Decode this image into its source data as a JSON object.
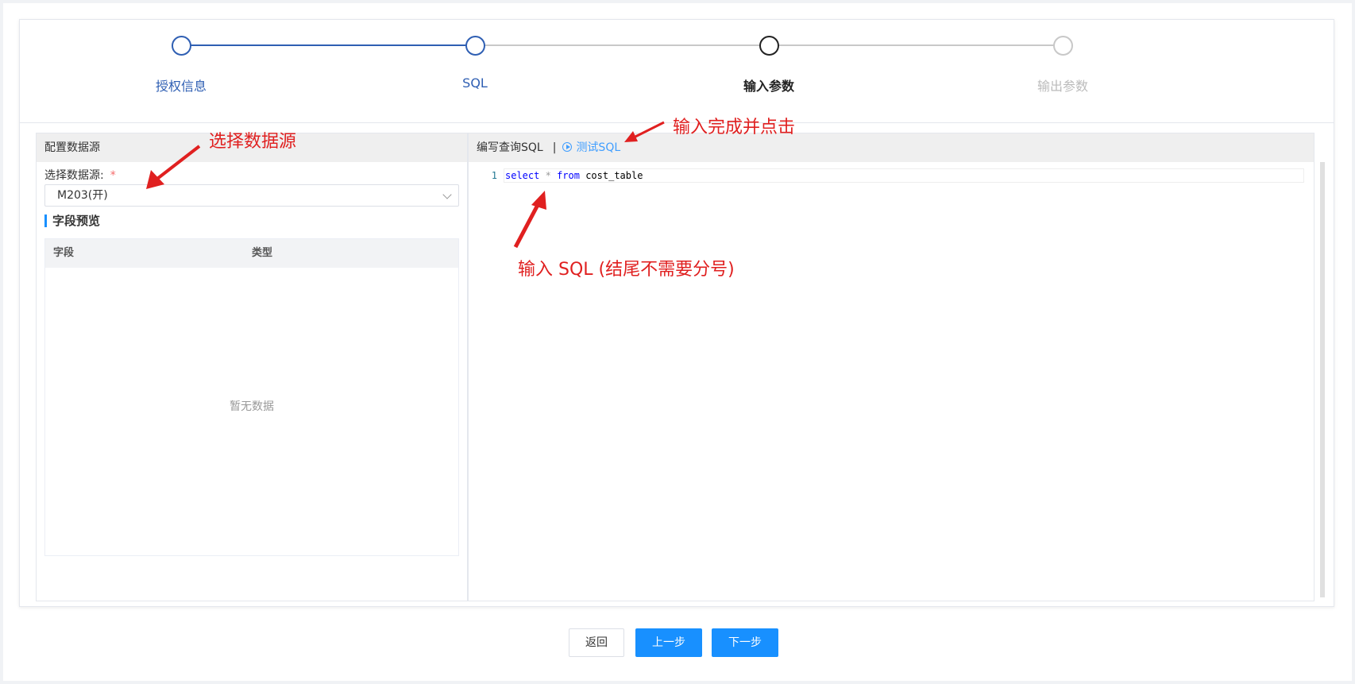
{
  "steps": [
    {
      "label": "授权信息",
      "state": "done"
    },
    {
      "label": "SQL",
      "state": "done"
    },
    {
      "label": "输入参数",
      "state": "current"
    },
    {
      "label": "输出参数",
      "state": "pending"
    }
  ],
  "left_panel": {
    "title": "配置数据源",
    "datasource_label": "选择数据源:",
    "required_mark": "*",
    "datasource_value": "M203(开)",
    "preview_title": "字段预览",
    "columns": [
      "字段",
      "类型"
    ],
    "empty_text": "暂无数据"
  },
  "right_panel": {
    "title": "编写查询SQL",
    "separator": "|",
    "test_sql_label": "测试SQL",
    "line_number": "1",
    "sql": {
      "kw1": "select",
      "op": "*",
      "kw2": "from",
      "table": "cost_table"
    }
  },
  "footer": {
    "back_label": "返回",
    "prev_label": "上一步",
    "next_label": "下一步"
  },
  "annotations": {
    "select_ds": "选择数据源",
    "click_test": "输入完成并点击",
    "enter_sql": "输入 SQL (结尾不需要分号)"
  },
  "colors": {
    "primary": "#1890ff",
    "step_active": "#2f5fb3",
    "annotation": "#e02020"
  }
}
